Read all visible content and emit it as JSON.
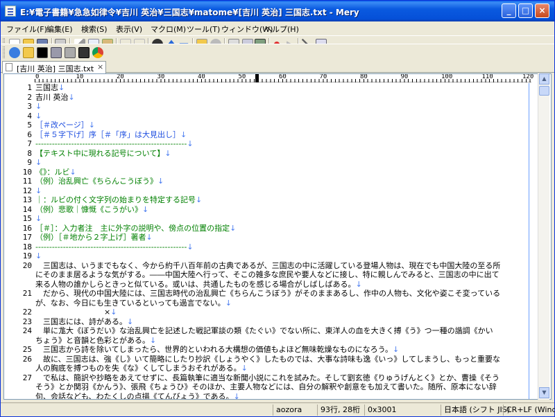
{
  "window": {
    "title": "E:¥電子書籍¥急急如律令¥吉川 英治¥三国志¥matome¥[吉川 英治] 三国志.txt - Mery",
    "controls": {
      "minimize": "_",
      "maximize": "□",
      "close": "×"
    }
  },
  "menu": [
    "ファイル(F)",
    "編集(E)",
    "検索(S)",
    "表示(V)",
    "マクロ(M)",
    "ツール(T)",
    "ウィンドウ(W)",
    "ヘルプ(H)"
  ],
  "toolbar1_icons": [
    "new-file-icon",
    "open-file-icon",
    "save-icon",
    "print-icon",
    "cut-icon",
    "copy-icon",
    "paste-icon",
    "undo-icon",
    "redo-icon",
    "find-icon",
    "find-previous-icon",
    "find-next-icon",
    "replace-icon",
    "find-in-files-icon",
    "output-icon",
    "document-icon",
    "toggle-icon",
    "record-macro-icon",
    "run-macro-icon",
    "pin-icon",
    "settings-icon"
  ],
  "toolbar2_icons": [
    "ie-icon",
    "folder-icon",
    "cmd-icon",
    "calculator-icon",
    "tools-icon",
    "putty-icon",
    "chrome-icon"
  ],
  "tab": {
    "label": "[吉川 英治] 三国志.txt",
    "close": "×"
  },
  "ruler": {
    "labels": [
      "0",
      "10",
      "20",
      "30",
      "40",
      "50",
      "60",
      "70",
      "80",
      "90",
      "100",
      "110",
      "120"
    ]
  },
  "lines": [
    {
      "n": "1",
      "t": "三国志",
      "c": "",
      "e": "↓"
    },
    {
      "n": "2",
      "t": "吉川 英治",
      "c": "",
      "e": "↓"
    },
    {
      "n": "3",
      "t": "",
      "c": "",
      "e": "↓"
    },
    {
      "n": "4",
      "t": "",
      "c": "",
      "e": "↓"
    },
    {
      "n": "5",
      "t": "［＃改ページ］",
      "c": "blue",
      "e": "↓"
    },
    {
      "n": "6",
      "t": "［＃５字下げ］序［＃「序」は大見出し］",
      "c": "blue",
      "e": "↓"
    },
    {
      "n": "7",
      "t": "-------------------------------------------------------",
      "c": "green",
      "e": "↓"
    },
    {
      "n": "8",
      "t": "【テキスト中に現れる記号について】",
      "c": "green",
      "e": "↓"
    },
    {
      "n": "9",
      "t": "",
      "c": "",
      "e": "↓"
    },
    {
      "n": "10",
      "t": "《》：ルビ",
      "c": "green",
      "e": "↓"
    },
    {
      "n": "11",
      "t": "（例）治乱興亡《ちらんこうぼう》",
      "c": "green",
      "e": "↓"
    },
    {
      "n": "12",
      "t": "",
      "c": "",
      "e": "↓"
    },
    {
      "n": "13",
      "t": "｜：ルビの付く文字列の始まりを特定する記号",
      "c": "green",
      "e": "↓"
    },
    {
      "n": "14",
      "t": "（例）悲歌｜慷慨《こうがい》",
      "c": "green",
      "e": "↓"
    },
    {
      "n": "15",
      "t": "",
      "c": "",
      "e": "↓"
    },
    {
      "n": "16",
      "t": "［＃］：入力者注　主に外字の説明や、傍点の位置の指定",
      "c": "green",
      "e": "↓"
    },
    {
      "n": "17",
      "t": "（例）［＃地から２字上げ］著者",
      "c": "green",
      "e": "↓"
    },
    {
      "n": "18",
      "t": "-------------------------------------------------------",
      "c": "green",
      "e": "↓"
    },
    {
      "n": "19",
      "t": "",
      "c": "",
      "e": "↓"
    },
    {
      "n": "20",
      "t": "　三国志は、いうまでもなく、今から約千八百年前の古典であるが、三国志の中に活躍している登場人物は、現在でも中国大陸の至る所",
      "c": "",
      "e": ""
    },
    {
      "n": "",
      "t": "にそのまま居るような気がする。――中国大陸へ行って、そこの雑多な庶民や要人などに接し、特に親しんでみると、三国志の中に出て",
      "c": "",
      "e": ""
    },
    {
      "n": "",
      "t": "来る人物の誰かしらときっと似ている。或いは、共通したものを感じる場合がしばしばある。",
      "c": "",
      "e": "↓"
    },
    {
      "n": "21",
      "t": "　だから、現代の中国大陸には、三国志時代の治乱興亡《ちらんこうぼう》がそのままあるし、作中の人物も、文化や姿こそ変っている",
      "c": "",
      "e": ""
    },
    {
      "n": "",
      "t": "が、なお、今日にも生きているといっても過言でない。",
      "c": "",
      "e": "↓"
    },
    {
      "n": "22",
      "t": "　　　　　　　　　×",
      "c": "",
      "e": "↓"
    },
    {
      "n": "23",
      "t": "　三国志には、詩がある。",
      "c": "",
      "e": "↓"
    },
    {
      "n": "24",
      "t": "　単に尨大《ぼうだい》な治乱興亡を記述した戦記軍談の類《たぐい》でない所に、東洋人の血を大きく搏《う》つ一種の諧調《かい",
      "c": "",
      "e": ""
    },
    {
      "n": "",
      "t": "ちょう》と音韻と色彩とがある。",
      "c": "",
      "e": "↓"
    },
    {
      "n": "25",
      "t": "　三国志から詩を除いてしまったら、世界的といわれる大構想の価値もよほど無味乾燥なものになろう。",
      "c": "",
      "e": "↓"
    },
    {
      "n": "26",
      "t": "　故に、三国志は、強《し》いて簡略にしたり抄訳《しょうやく》したものでは、大事な詩味も逸《いっ》してしまうし、もっと重要な",
      "c": "",
      "e": ""
    },
    {
      "n": "",
      "t": "人の胸底を搏つものを失《な》くしてしまうおそれがある。",
      "c": "",
      "e": "↓"
    },
    {
      "n": "27",
      "t": "　で私は、簡訳や抄略をあえてせずに、長篇執筆に適当な新聞小説にこれを試みた。そして劉玄徳《りゅうげんとく》とか、曹操《そう",
      "c": "",
      "e": ""
    },
    {
      "n": "",
      "t": "そう》とか関羽《かんう》、張飛《ちょうひ》そのほか、主要人物などには、自分の解釈や創意をも加えて書いた。随所、原本にない辞",
      "c": "",
      "e": ""
    },
    {
      "n": "",
      "t": "句、会話なども、わたくしの点描《てんびょう》である。",
      "c": "",
      "e": "↓"
    }
  ],
  "status": {
    "mode": "aozora",
    "lines": "93行, 28桁",
    "code": "0x3001",
    "encoding": "日本語 (シフト JIS)",
    "eol": "CR+LF (Windows)"
  }
}
